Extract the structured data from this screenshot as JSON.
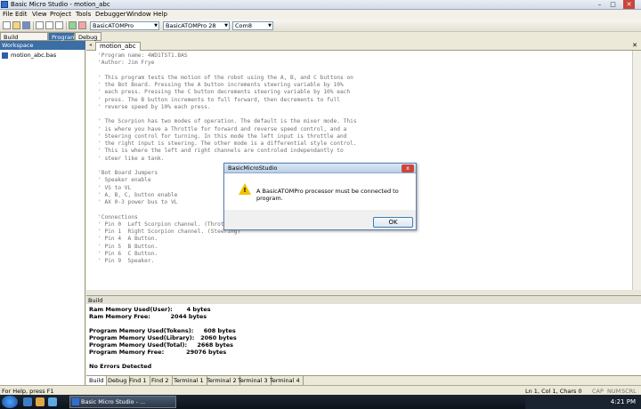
{
  "window": {
    "title": "Basic Micro Studio - motion_abc",
    "controls": [
      "–",
      "□",
      "✕"
    ]
  },
  "menu": [
    "File",
    "Edit",
    "View",
    "Project",
    "Tools",
    "Debugger",
    "Window",
    "Help"
  ],
  "toolbar": {
    "processor": "BasicATOMPro",
    "chip": "BasicATOMPro 28",
    "port": "Com8"
  },
  "tabs": {
    "build": "Build motion_abc.bas",
    "program": "Program",
    "debug": "Debug"
  },
  "workspace": {
    "header": "Workspace",
    "file": "motion_abc.bas"
  },
  "editor": {
    "tab": "motion_abc",
    "close": "✕",
    "code": [
      "'Program name: 4WD1TST1.BAS",
      "'Author: Jim Frye",
      "",
      "' This program tests the motion of the robot using the A, B, and C buttons on",
      "' the Bot Board. Pressing the A button increments steering variable by 10%",
      "' each press. Pressing the C button decrements steering variable by 10% each",
      "' press. The B button increments to full forward, then decrements to full",
      "' reverse speed by 10% each press.",
      "",
      "' The Scorpion has two modes of operation. The default is the mixer mode. This",
      "' is where you have a Throttle for forward and reverse speed control, and a",
      "' Steering control for turning. In this mode the left input is throttle and",
      "' the right input is steering. The other mode is a differential style control.",
      "' This is where the left and right channels are controled independantly to",
      "' steer like a tank.",
      "",
      "'Bot Board Jumpers",
      "' Speaker enable",
      "' VS to VL",
      "' A, B, C, button enable",
      "' AX 0-3 power bus to VL",
      "",
      "'Connections",
      "' Pin 0  Left Scorpion channel. (Throttle)",
      "' Pin 1  Right Scorpion channel. (Steering)",
      "' Pin 4  A Button.",
      "' Pin 5  B Button.",
      "' Pin 6  C Button.",
      "' Pin 9  Speaker."
    ]
  },
  "build": {
    "header": "Build",
    "lines": [
      "Ram Memory Used(User):       4 bytes",
      "Ram Memory Free:          2044 bytes",
      "",
      "Program Memory Used(Tokens):     608 bytes",
      "Program Memory Used(Library):   2060 bytes",
      "Program Memory Used(Total):     2668 bytes",
      "Program Memory Free:           29076 bytes",
      "",
      "No Errors Detected"
    ],
    "tabs": [
      "Build",
      "Debug",
      "Find 1",
      "Find 2",
      "Terminal 1",
      "Terminal 2",
      "Terminal 3",
      "Terminal 4"
    ]
  },
  "status": {
    "help": "For Help, press F1",
    "position": "Ln 1, Col 1, Chars 0",
    "keys": [
      "CAP",
      "NUM",
      "SCRL"
    ]
  },
  "dialog": {
    "title": "BasicMicroStudio",
    "close": "x",
    "message": "A BasicATOMPro processor must be connected to program.",
    "ok": "OK",
    "icon": "warning-icon"
  },
  "taskbar": {
    "item": "Basic Micro Studio - ...",
    "clock": "4:21 PM"
  }
}
